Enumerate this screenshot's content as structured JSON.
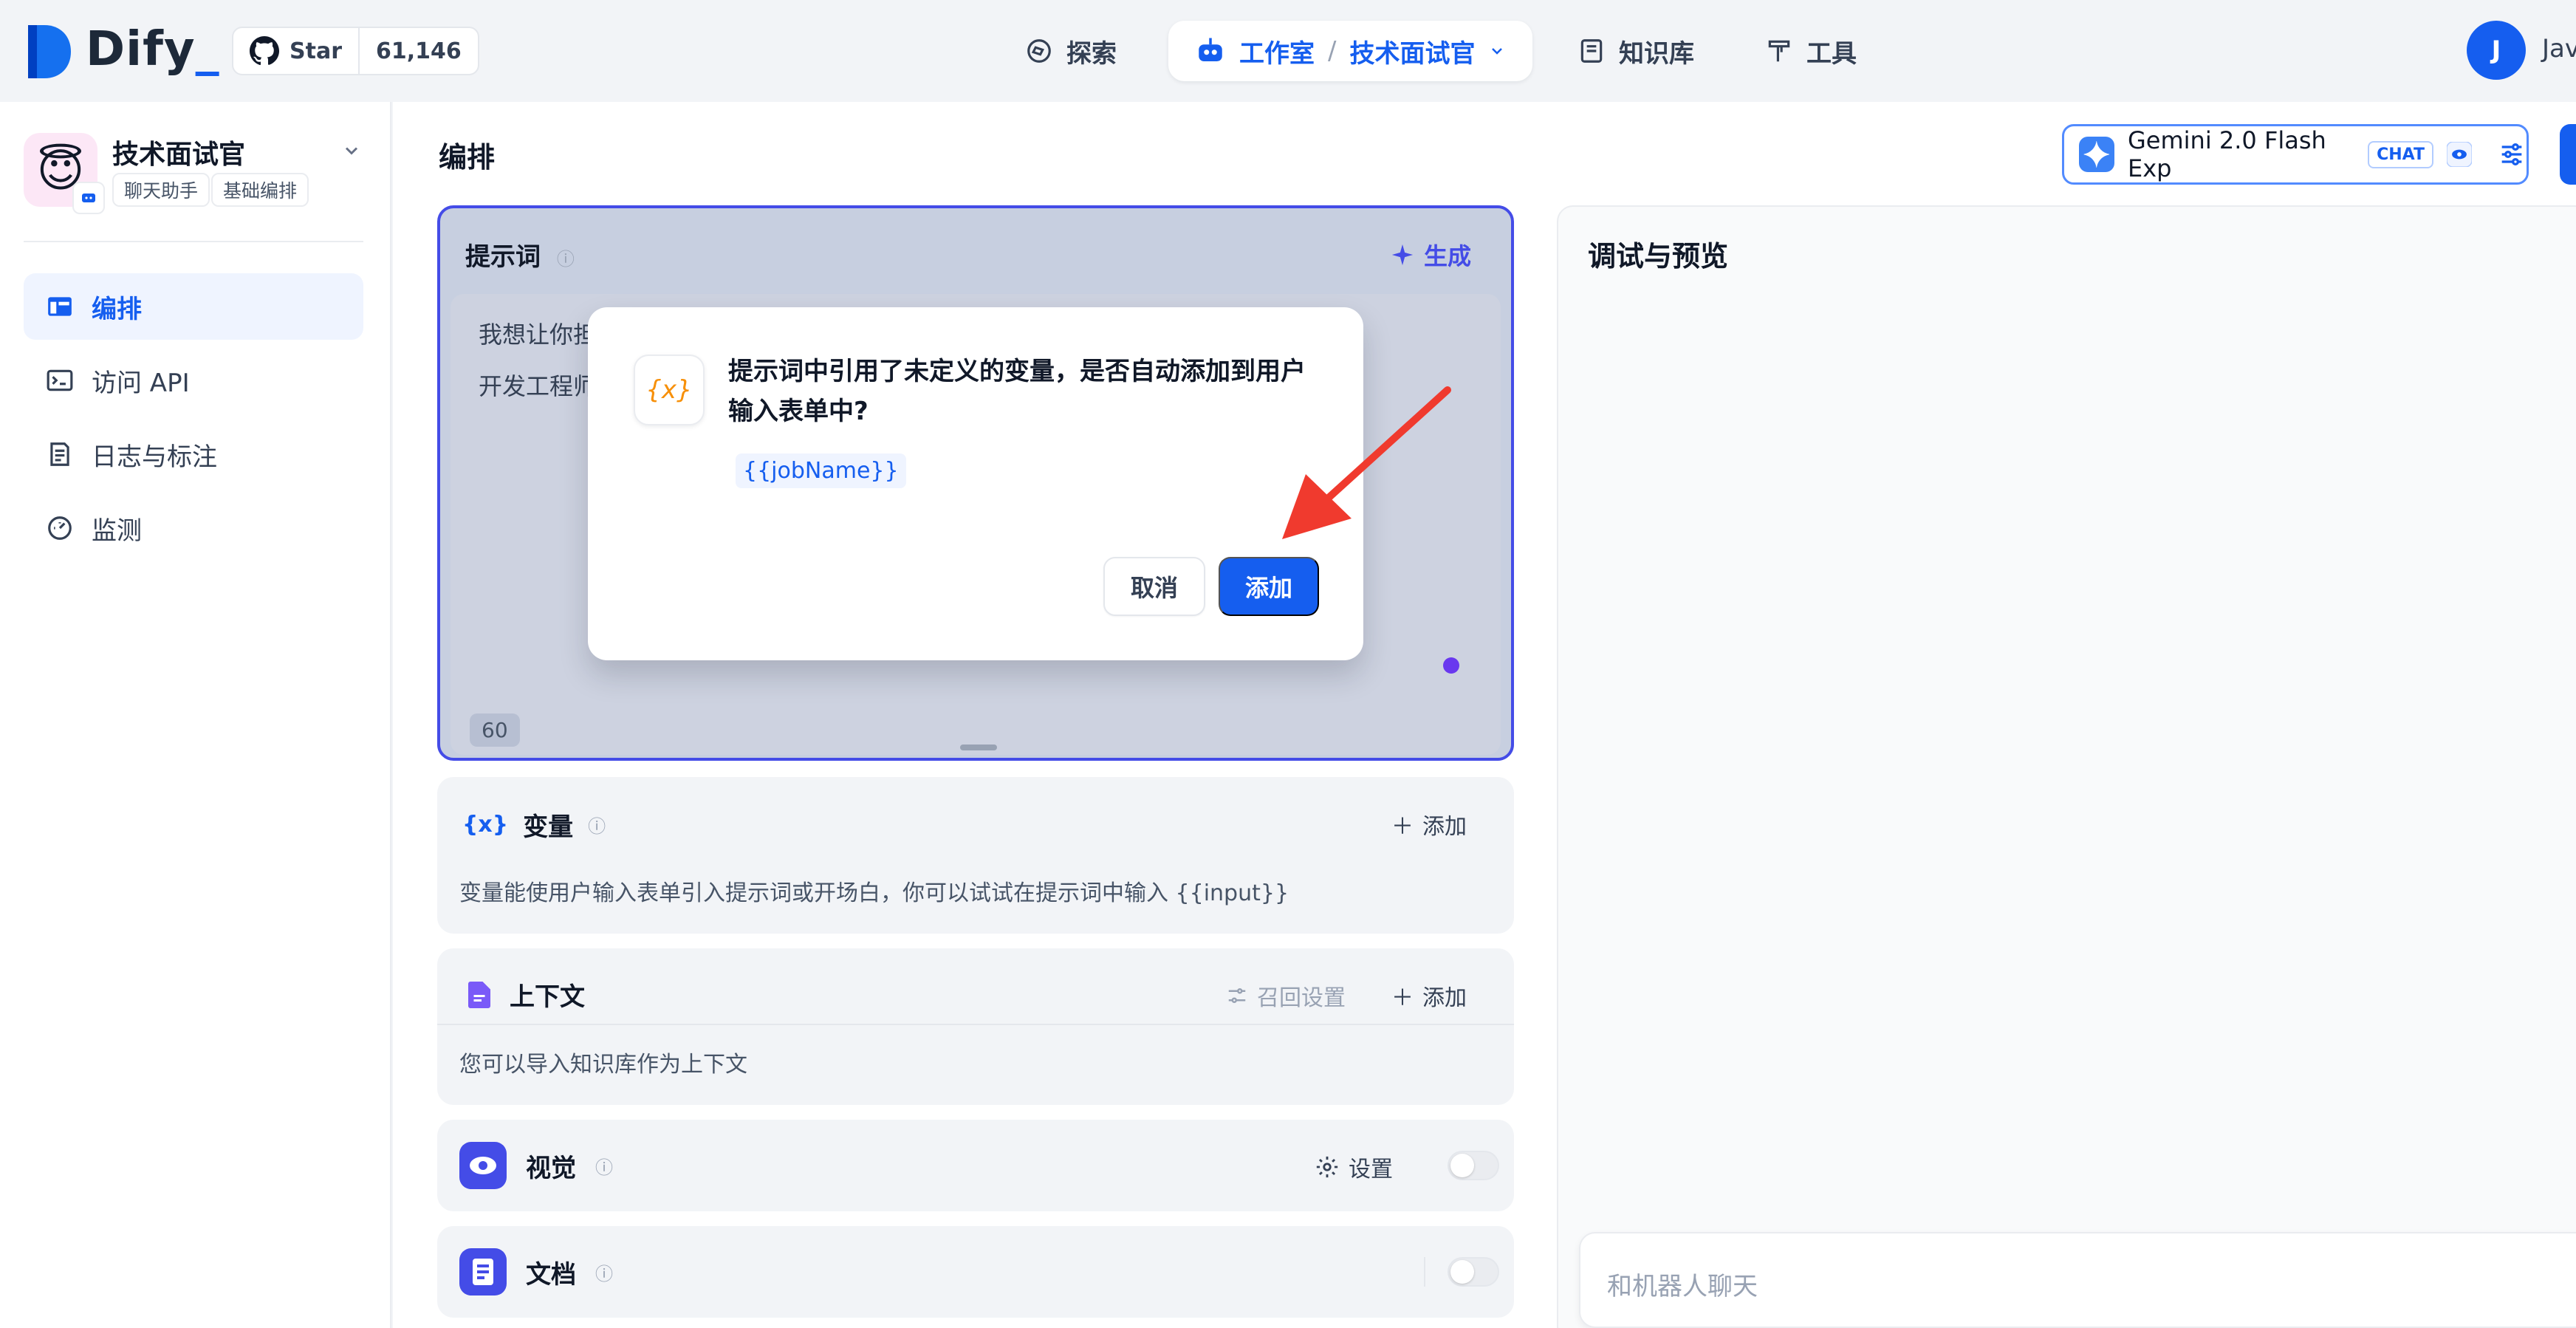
{
  "header": {
    "logo": "Dify",
    "github": {
      "star_label": "Star",
      "count": "61,146"
    },
    "nav": {
      "explore": "探索",
      "studio": "工作室",
      "separator": "/",
      "current_app": "技术面试官",
      "knowledge": "知识库",
      "tools": "工具"
    },
    "user": {
      "initial": "J",
      "name": "Jav"
    }
  },
  "sidebar": {
    "app": {
      "icon": "😇",
      "name": "技术面试官",
      "tags": [
        "聊天助手",
        "基础编排"
      ]
    },
    "items": [
      {
        "label": "编排",
        "icon": "layout-icon",
        "active": true
      },
      {
        "label": "访问 API",
        "icon": "terminal-icon",
        "active": false
      },
      {
        "label": "日志与标注",
        "icon": "file-list-icon",
        "active": false
      },
      {
        "label": "监测",
        "icon": "dashboard-icon",
        "active": false
      }
    ]
  },
  "main": {
    "title": "编排",
    "model": {
      "name": "Gemini 2.0 Flash Exp",
      "mode": "CHAT"
    },
    "prompt": {
      "title": "提示词",
      "generate": "生成",
      "text_line1": "我想让你担",
      "text_line2": "开发工程师",
      "count": "60"
    },
    "variables": {
      "title": "变量",
      "add": "添加",
      "desc": "变量能使用户输入表单引入提示词或开场白，你可以试试在提示词中输入 {{input}}"
    },
    "context": {
      "title": "上下文",
      "recall": "召回设置",
      "add": "添加",
      "desc": "您可以导入知识库作为上下文"
    },
    "vision": {
      "title": "视觉",
      "settings": "设置"
    },
    "document": {
      "title": "文档"
    }
  },
  "preview": {
    "title": "调试与预览",
    "placeholder": "和机器人聊天"
  },
  "dialog": {
    "icon_text": "{x}",
    "message": "提示词中引用了未定义的变量，是否自动添加到用户输入表单中?",
    "variable": "{{jobName}}",
    "cancel": "取消",
    "add": "添加"
  },
  "colors": {
    "accent": "#155eef",
    "prompt_border": "#444ce7",
    "arrow": "#f03a2e"
  }
}
